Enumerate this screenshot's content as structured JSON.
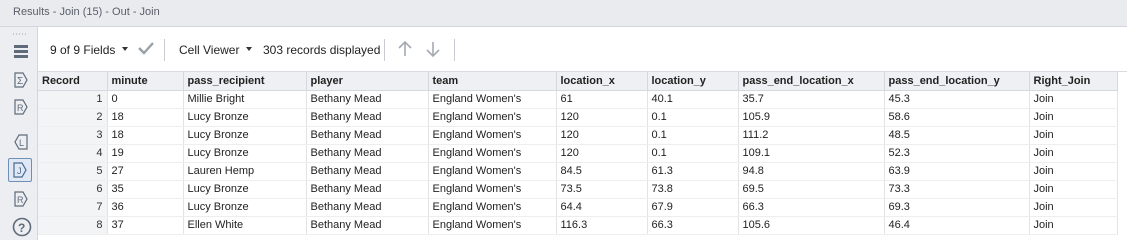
{
  "window": {
    "title": "Results - Join (15) - Out - Join"
  },
  "toolbar": {
    "fields_label": "9 of 9 Fields",
    "viewer_label": "Cell Viewer",
    "records_label": "303 records displayed"
  },
  "colors": {
    "accent": "#6f8fb5",
    "header_bg": "#eef0f3",
    "titlebar_bg": "#e9ebef"
  },
  "sidebar": {
    "icons": [
      "table-view-icon",
      "sum-icon",
      "right-r-icon",
      "left-l-icon",
      "join-j-icon",
      "right-r-output-icon",
      "help-icon"
    ]
  },
  "grid": {
    "columns": [
      "Record",
      "minute",
      "pass_recipient",
      "player",
      "team",
      "location_x",
      "location_y",
      "pass_end_location_x",
      "pass_end_location_y",
      "Right_Join"
    ],
    "rows": [
      [
        "1",
        "0",
        "Millie Bright",
        "Bethany Mead",
        "England Women's",
        "61",
        "40.1",
        "35.7",
        "45.3",
        "Join"
      ],
      [
        "2",
        "18",
        "Lucy Bronze",
        "Bethany Mead",
        "England Women's",
        "120",
        "0.1",
        "105.9",
        "58.6",
        "Join"
      ],
      [
        "3",
        "18",
        "Lucy Bronze",
        "Bethany Mead",
        "England Women's",
        "120",
        "0.1",
        "111.2",
        "48.5",
        "Join"
      ],
      [
        "4",
        "19",
        "Lucy Bronze",
        "Bethany Mead",
        "England Women's",
        "120",
        "0.1",
        "109.1",
        "52.3",
        "Join"
      ],
      [
        "5",
        "27",
        "Lauren Hemp",
        "Bethany Mead",
        "England Women's",
        "84.5",
        "61.3",
        "94.8",
        "63.9",
        "Join"
      ],
      [
        "6",
        "35",
        "Lucy Bronze",
        "Bethany Mead",
        "England Women's",
        "73.5",
        "73.8",
        "69.5",
        "73.3",
        "Join"
      ],
      [
        "7",
        "36",
        "Lucy Bronze",
        "Bethany Mead",
        "England Women's",
        "64.4",
        "67.9",
        "66.3",
        "69.3",
        "Join"
      ],
      [
        "8",
        "37",
        "Ellen White",
        "Bethany Mead",
        "England Women's",
        "116.3",
        "66.3",
        "105.6",
        "46.4",
        "Join"
      ]
    ]
  }
}
